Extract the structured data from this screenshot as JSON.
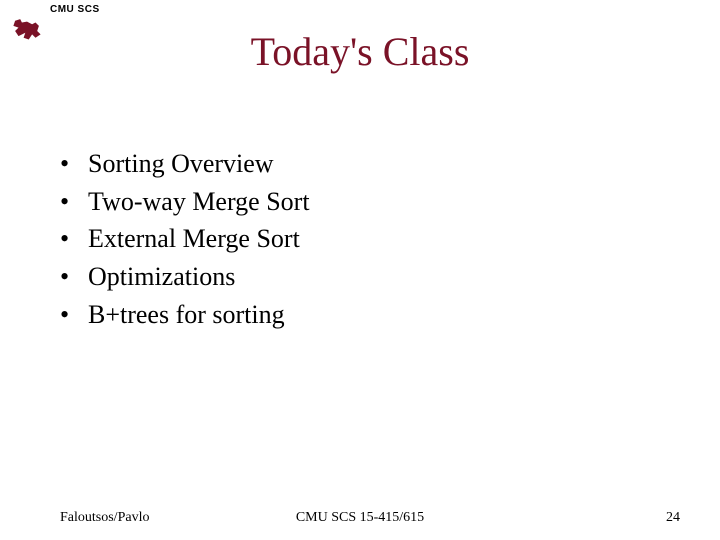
{
  "header": {
    "org": "CMU SCS",
    "logo_color": "#7a1227"
  },
  "title": "Today's Class",
  "bullets": [
    "Sorting Overview",
    "Two-way Merge Sort",
    "External Merge Sort",
    "Optimizations",
    "B+trees for sorting"
  ],
  "footer": {
    "left": "Faloutsos/Pavlo",
    "center": "CMU SCS 15-415/615",
    "right": "24"
  }
}
